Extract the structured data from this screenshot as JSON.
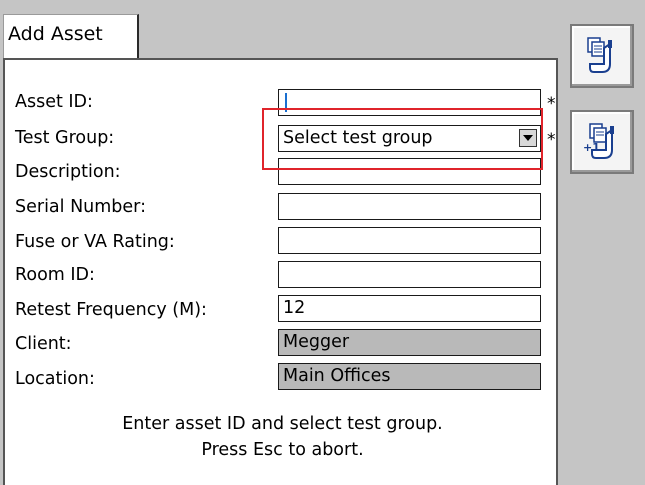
{
  "window": {
    "tab_title": "Add Asset"
  },
  "form": {
    "fields": [
      {
        "label": "Asset ID:",
        "value": "",
        "required": "*"
      },
      {
        "label": "Test Group:",
        "value": "Select test group",
        "required": "*"
      },
      {
        "label": "Description:",
        "value": ""
      },
      {
        "label": "Serial Number:",
        "value": ""
      },
      {
        "label": "Fuse or VA Rating:",
        "value": ""
      },
      {
        "label": "Room ID:",
        "value": ""
      },
      {
        "label": "Retest Frequency (M):",
        "value": "12"
      },
      {
        "label": "Client:",
        "value": "Megger"
      },
      {
        "label": "Location:",
        "value": "Main Offices"
      }
    ]
  },
  "instructions": {
    "line1": "Enter asset ID and select test group.",
    "line2": "Press Esc to abort."
  },
  "side_buttons": [
    {
      "icon": "copy-asset-icon"
    },
    {
      "icon": "copy-asset-increment-icon",
      "badge": "+1"
    }
  ],
  "colors": {
    "highlight": "#e0242b",
    "readonly_field": "#b9b9b9",
    "caret": "#1a6fd0"
  }
}
